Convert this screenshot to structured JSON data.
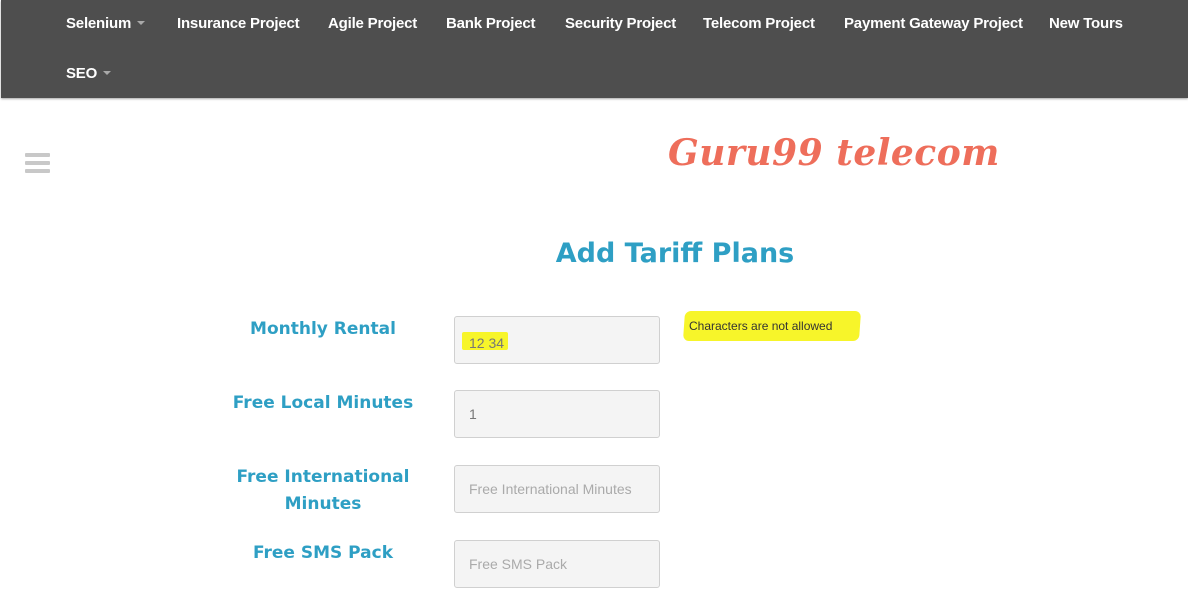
{
  "navbar": {
    "items": [
      {
        "label": "Selenium",
        "has_dropdown": true
      },
      {
        "label": "Insurance Project"
      },
      {
        "label": "Agile Project"
      },
      {
        "label": "Bank Project"
      },
      {
        "label": "Security Project"
      },
      {
        "label": "Telecom Project"
      },
      {
        "label": "Payment Gateway Project"
      },
      {
        "label": "New Tours"
      },
      {
        "label": "SEO",
        "has_dropdown": true
      }
    ]
  },
  "brand": {
    "title": "Guru99 telecom"
  },
  "form": {
    "heading": "Add Tariff Plans",
    "fields": [
      {
        "label": "Monthly Rental",
        "value": "12 34",
        "placeholder": "",
        "error": "Characters are not allowed"
      },
      {
        "label": "Free Local Minutes",
        "value": "1",
        "placeholder": ""
      },
      {
        "label": "Free International Minutes",
        "value": "",
        "placeholder": "Free International Minutes"
      },
      {
        "label": "Free SMS Pack",
        "value": "",
        "placeholder": "Free SMS Pack"
      }
    ]
  },
  "colors": {
    "navbar_bg": "#4e4e4e",
    "accent": "#2e9fc4",
    "brand": "#ee6e5b",
    "highlight": "#f7f52a"
  },
  "icons": {
    "menu": "hamburger-menu-icon",
    "dropdown": "caret-down-icon"
  }
}
